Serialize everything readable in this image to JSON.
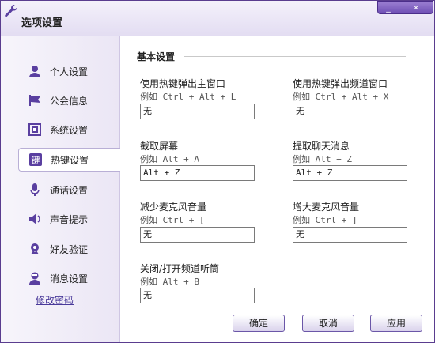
{
  "window": {
    "title": "选项设置",
    "minimize_glyph": "_",
    "close_glyph": "×"
  },
  "sidebar": {
    "items": [
      {
        "label": "个人设置",
        "icon": "person-icon"
      },
      {
        "label": "公会信息",
        "icon": "flag-icon"
      },
      {
        "label": "系统设置",
        "icon": "system-icon"
      },
      {
        "label": "热键设置",
        "icon": "hotkey-icon",
        "active": true
      },
      {
        "label": "通话设置",
        "icon": "microphone-icon"
      },
      {
        "label": "声音提示",
        "icon": "speaker-icon"
      },
      {
        "label": "好友验证",
        "icon": "friend-verify-icon"
      },
      {
        "label": "消息设置",
        "icon": "message-icon"
      }
    ],
    "change_password": "修改密码"
  },
  "section": {
    "title": "基本设置"
  },
  "fields": [
    {
      "label": "使用热键弹出主窗口",
      "example": "例如 Ctrl + Alt + L",
      "value": "无"
    },
    {
      "label": "使用热键弹出频道窗口",
      "example": "例如 Ctrl + Alt + X",
      "value": "无"
    },
    {
      "label": "截取屏幕",
      "example": "例如 Alt + A",
      "value": "Alt + Z"
    },
    {
      "label": "提取聊天消息",
      "example": "例如 Alt + Z",
      "value": "Alt + Z"
    },
    {
      "label": "减少麦克风音量",
      "example": "例如 Ctrl + [",
      "value": "无"
    },
    {
      "label": "增大麦克风音量",
      "example": "例如 Ctrl + ]",
      "value": "无"
    },
    {
      "label": "关闭/打开频道听筒",
      "example": "例如 Alt + B",
      "value": "无"
    }
  ],
  "buttons": {
    "ok": "确定",
    "cancel": "取消",
    "apply": "应用"
  },
  "colors": {
    "accent": "#6f4fb4",
    "icon": "#5a3fa0"
  }
}
